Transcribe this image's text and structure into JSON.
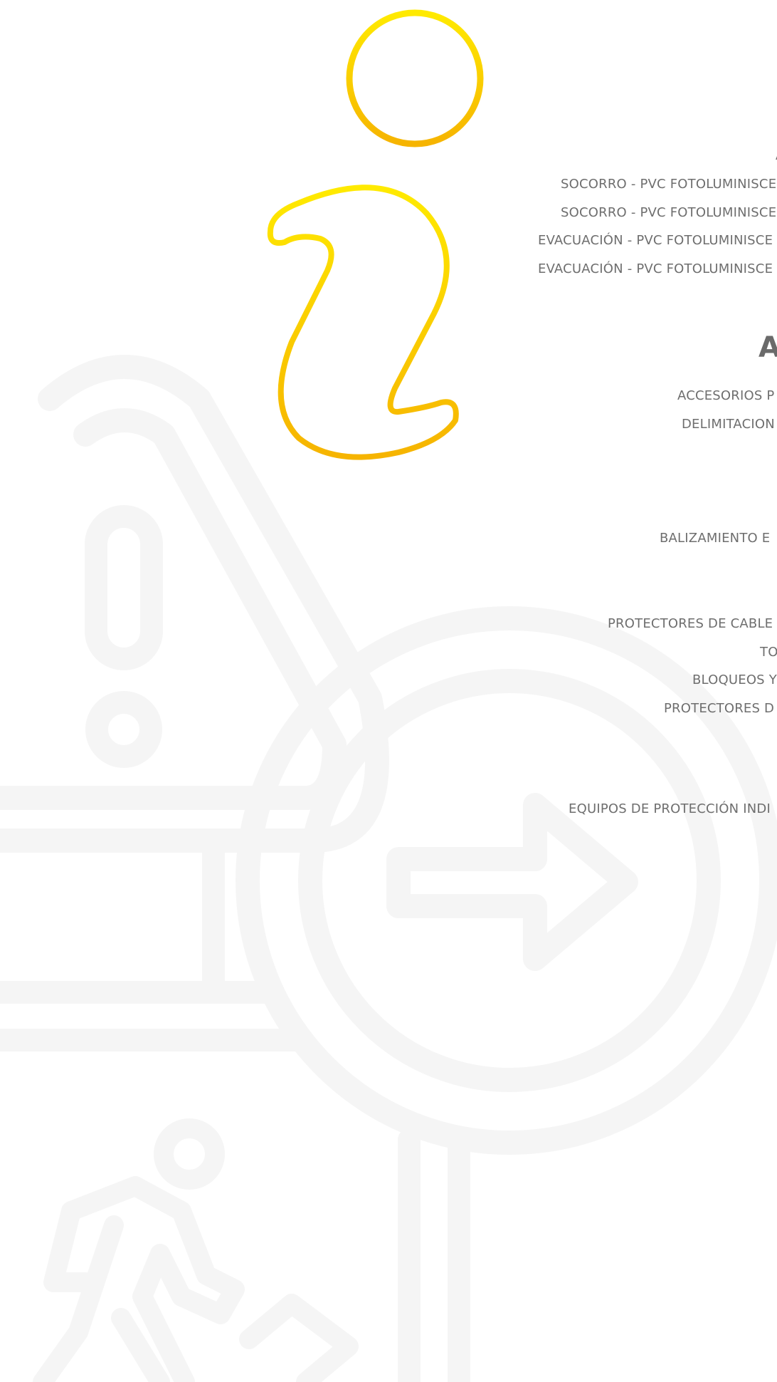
{
  "colors": {
    "icon_gray": "#f5f5f5",
    "info_yellow_top": "#ffe500",
    "info_yellow_bottom": "#f7b500",
    "text_gray": "#6e6e6e"
  },
  "icons": {
    "info_icon": "info-icon",
    "warning_sign_icon": "warning-sign-icon",
    "direction_sign_icon": "direction-sign-icon",
    "pedestrian_icon": "pedestrian-icon"
  },
  "menu": {
    "line_a": "A",
    "socorro_1": "SOCORRO - PVC FOTOLUMINISCE",
    "socorro_2": "SOCORRO - PVC FOTOLUMINISCE",
    "evacuacion_1": "EVACUACIÓN - PVC FOTOLUMINISCE",
    "evacuacion_2": "EVACUACIÓN - PVC FOTOLUMINISCE",
    "heading_a": "A",
    "accesorios": "ACCESORIOS P",
    "delimitacion": "DELIMITACION",
    "balizamiento": "BALIZAMIENTO E",
    "protectores_cables": "PROTECTORES DE CABLE",
    "to": "TO",
    "bloqueos": "BLOQUEOS Y",
    "protectores_d": "PROTECTORES D",
    "equipos": "EQUIPOS DE PROTECCIÓN INDI"
  }
}
